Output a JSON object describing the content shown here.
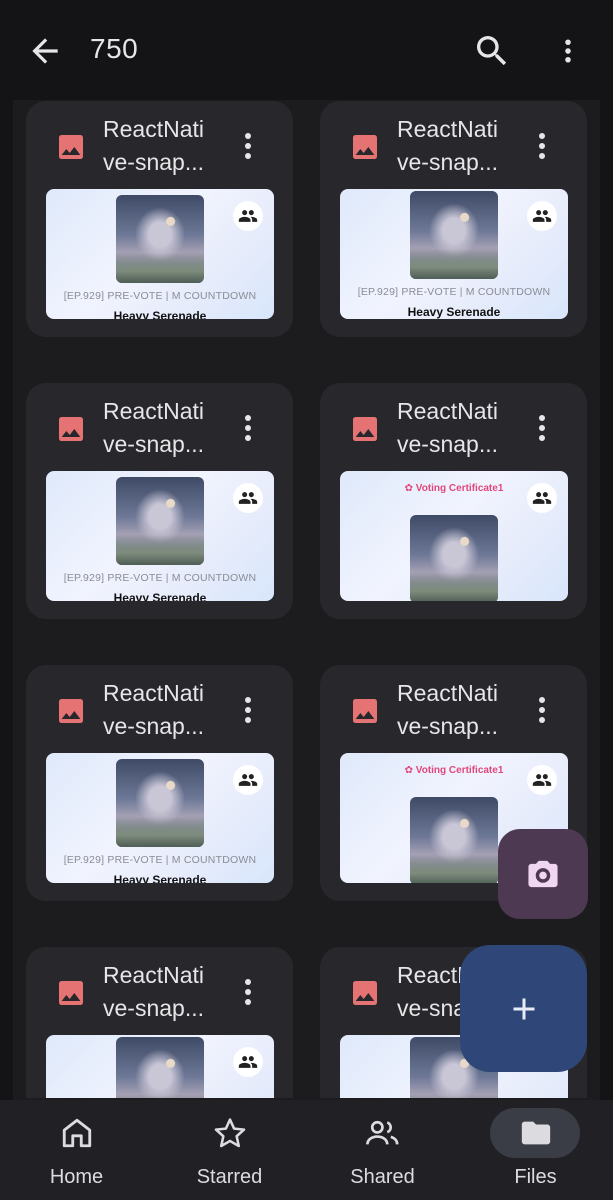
{
  "header": {
    "title": "750",
    "back_icon": "arrow-back-icon",
    "search_icon": "search-icon",
    "more_icon": "more-vert-icon"
  },
  "files": [
    {
      "name_line1": "ReactNati",
      "name_line2": "ve-snap...",
      "type": "image",
      "preview": "vote-screen",
      "caption": "[EP.929] PRE-VOTE | M COUNTDOWN",
      "song": "Heavy Serenade"
    },
    {
      "name_line1": "ReactNati",
      "name_line2": "ve-snap...",
      "type": "image",
      "preview": "vote-screen",
      "caption": "[EP.929] PRE-VOTE | M COUNTDOWN",
      "song": "Heavy Serenade"
    },
    {
      "name_line1": "ReactNati",
      "name_line2": "ve-snap...",
      "type": "image",
      "preview": "vote-screen",
      "caption": "[EP.929] PRE-VOTE | M COUNTDOWN",
      "song": "Heavy Serenade"
    },
    {
      "name_line1": "ReactNati",
      "name_line2": "ve-snap...",
      "type": "image",
      "preview": "certificate",
      "certificate": "Voting Certificate1"
    },
    {
      "name_line1": "ReactNati",
      "name_line2": "ve-snap...",
      "type": "image",
      "preview": "vote-screen",
      "caption": "[EP.929] PRE-VOTE | M COUNTDOWN",
      "song": "Heavy Serenade"
    },
    {
      "name_line1": "ReactNati",
      "name_line2": "ve-snap...",
      "type": "image",
      "preview": "certificate",
      "certificate": "Voting Certificate1"
    },
    {
      "name_line1": "ReactNati",
      "name_line2": "ve-snap...",
      "type": "image",
      "preview": "vote-screen"
    },
    {
      "name_line1": "ReactN",
      "name_line2": "ve-snap...",
      "type": "image",
      "preview": "vote-screen"
    }
  ],
  "fabs": {
    "camera_icon": "camera-icon",
    "add_icon": "add-icon"
  },
  "nav": [
    {
      "label": "Home",
      "icon": "home-icon",
      "active": false
    },
    {
      "label": "Starred",
      "icon": "star-icon",
      "active": false
    },
    {
      "label": "Shared",
      "icon": "shared-people-icon",
      "active": false
    },
    {
      "label": "Files",
      "icon": "folder-icon",
      "active": true
    }
  ],
  "colors": {
    "background": "#141416",
    "card": "#28282c",
    "image_file_icon": "#e57373",
    "camera_fab": "#4d3a52",
    "add_fab": "#2f4778",
    "certificate_text": "#e0487c"
  }
}
